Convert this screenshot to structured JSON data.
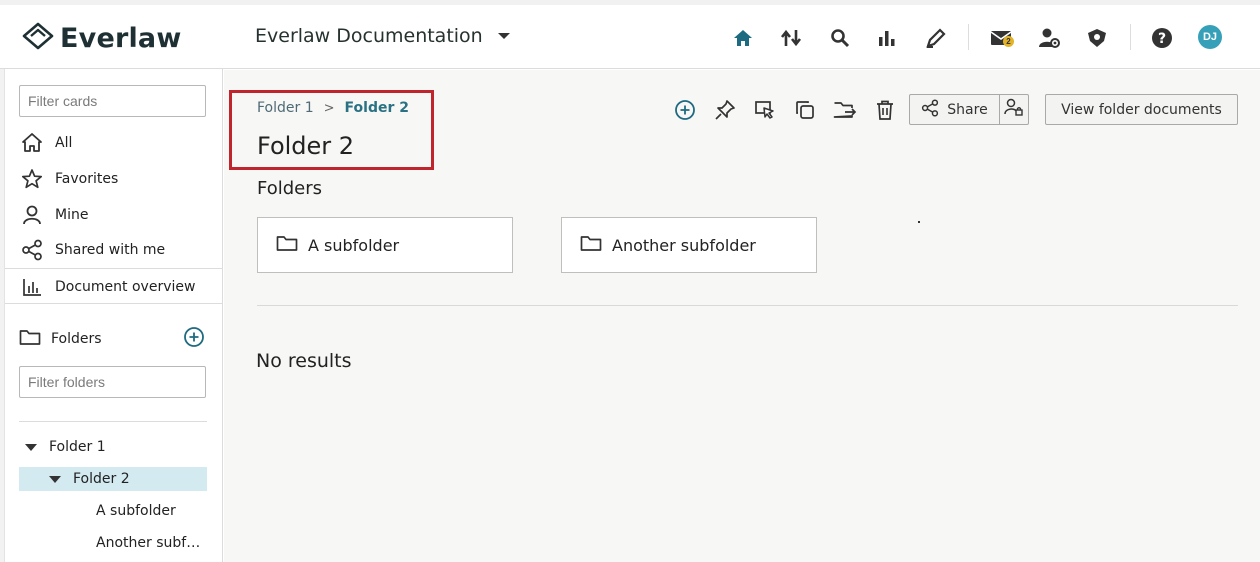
{
  "header": {
    "logo_text": "Everlaw",
    "project_name": "Everlaw Documentation",
    "nav_icons": [
      "home-icon",
      "upload-download-icon",
      "search-icon",
      "bar-chart-icon",
      "pen-icon",
      "mail-icon",
      "user-gear-icon",
      "shield-icon",
      "help-icon"
    ],
    "mail_badge": "2",
    "avatar_initials": "DJ",
    "accent_color": "#1e6a80"
  },
  "sidebar": {
    "filter_cards_placeholder": "Filter cards",
    "items": [
      {
        "label": "All",
        "icon": "home-icon"
      },
      {
        "label": "Favorites",
        "icon": "star-icon"
      },
      {
        "label": "Mine",
        "icon": "user-icon"
      },
      {
        "label": "Shared with me",
        "icon": "share-icon"
      }
    ],
    "document_overview": "Document overview",
    "folders_label": "Folders",
    "filter_folders_placeholder": "Filter folders",
    "tree": [
      {
        "label": "Folder 1",
        "expanded": true
      },
      {
        "label": "Folder 2",
        "expanded": true,
        "selected": true
      },
      {
        "label": "A subfolder"
      },
      {
        "label": "Another subfolder"
      }
    ]
  },
  "main": {
    "breadcrumb": [
      "Folder 1",
      "Folder 2"
    ],
    "breadcrumb_sep": ">",
    "title": "Folder 2",
    "toolbar_icons": [
      "add-circle-icon",
      "pin-icon",
      "select-cursor-icon",
      "copy-icon",
      "move-folder-icon",
      "trash-icon"
    ],
    "share_label": "Share",
    "view_docs_label": "View folder documents",
    "folders_section_title": "Folders",
    "subfolders": [
      "A subfolder",
      "Another subfolder"
    ],
    "no_results": "No results"
  }
}
